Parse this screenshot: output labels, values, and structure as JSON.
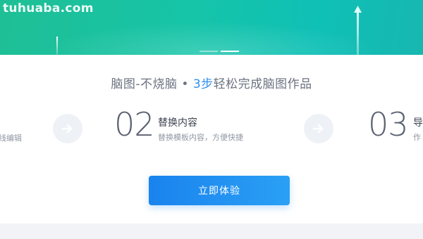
{
  "watermark": "tuhuaba.com",
  "hero": {
    "colors": {
      "start": "#1fbf95",
      "end": "#17b7b0"
    },
    "carousel_dots": 2,
    "active_dot": 1
  },
  "headline": {
    "prefix": "脑图-不烧脑",
    "separator": "•",
    "accent": "3步",
    "suffix": "轻松完成脑图作品",
    "accent_color": "#2d8ff0"
  },
  "steps": [
    {
      "number": "",
      "title": "",
      "desc": "线编辑"
    },
    {
      "number": "02",
      "title": "替换内容",
      "desc": "替换模板内容，方便快捷"
    },
    {
      "number": "03",
      "title": "导",
      "desc": "作"
    }
  ],
  "arrows": [
    {
      "icon": "arrow-right-icon"
    },
    {
      "icon": "arrow-right-icon"
    }
  ],
  "cta": {
    "label": "立即体验",
    "color": "#1a83ee"
  }
}
